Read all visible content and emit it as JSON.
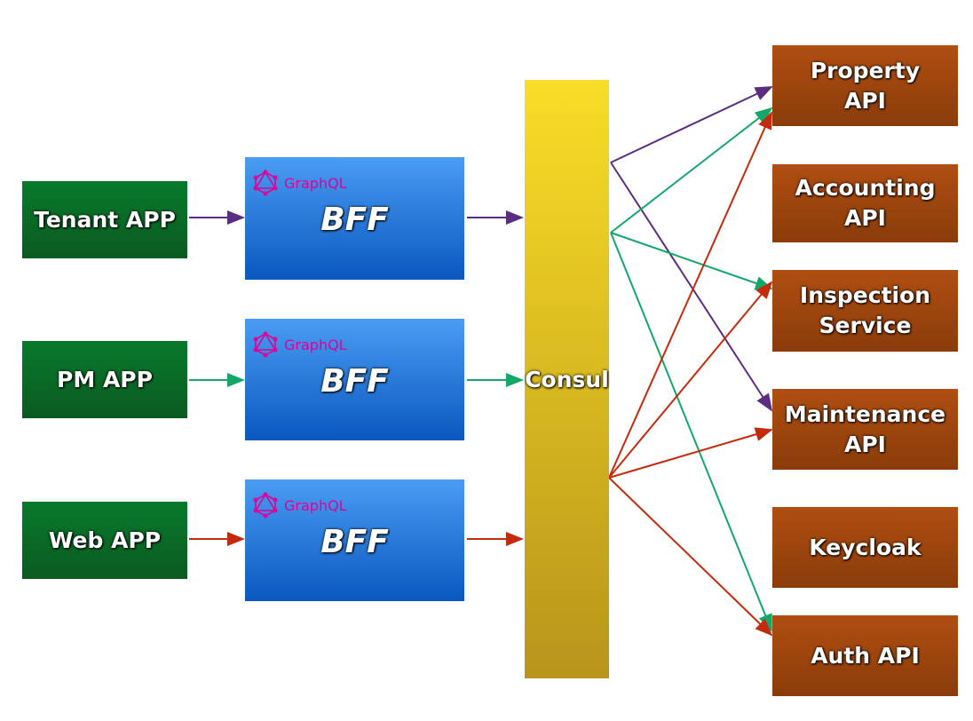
{
  "clients": [
    {
      "label": "Tenant APP",
      "line_color": "#5b2d82"
    },
    {
      "label": "PM APP",
      "line_color": "#13a86a"
    },
    {
      "label": "Web APP",
      "line_color": "#c42a0c"
    }
  ],
  "bff": {
    "label": "BFF",
    "badge": "GraphQL",
    "badge_color": "#e10098"
  },
  "gateway": {
    "label": "Consul"
  },
  "services": [
    {
      "label": "Property API"
    },
    {
      "label": "Accounting API"
    },
    {
      "label": "Inspection Service"
    },
    {
      "label": "Maintenance API"
    },
    {
      "label": "Keycloak"
    },
    {
      "label": "Auth API"
    }
  ],
  "routes": [
    {
      "from": "Tenant APP",
      "to": [
        "Property API",
        "Maintenance API"
      ]
    },
    {
      "from": "PM APP",
      "to": [
        "Property API",
        "Inspection Service",
        "Auth API"
      ]
    },
    {
      "from": "Web APP",
      "to": [
        "Property API",
        "Inspection Service",
        "Maintenance API",
        "Auth API"
      ]
    }
  ]
}
